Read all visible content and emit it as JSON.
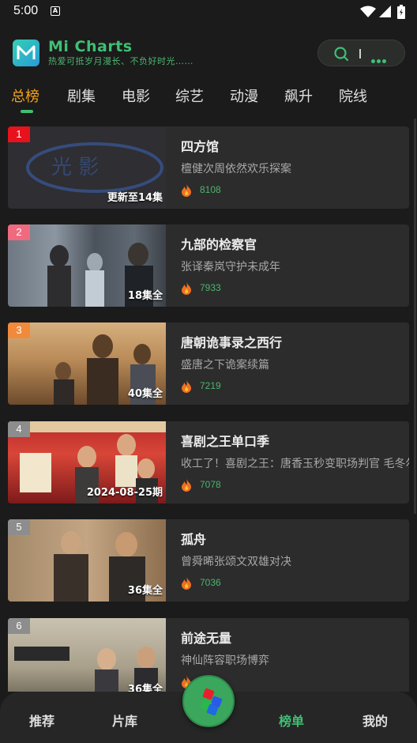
{
  "status_bar": {
    "time": "5:00",
    "notif_glyph": "A"
  },
  "header": {
    "app_title": "Mi Charts",
    "slogan": "热爱可抵岁月漫长、不负好时光……",
    "logo_letter": "M"
  },
  "tabs": [
    {
      "label": "总榜",
      "active": true
    },
    {
      "label": "剧集",
      "active": false
    },
    {
      "label": "电影",
      "active": false
    },
    {
      "label": "综艺",
      "active": false
    },
    {
      "label": "动漫",
      "active": false
    },
    {
      "label": "飙升",
      "active": false
    },
    {
      "label": "院线",
      "active": false
    }
  ],
  "items": [
    {
      "rank": "1",
      "rank_color": "#e8121c",
      "title": "四方馆",
      "desc": "檀健次周依然欢乐探案",
      "heat": "8108",
      "episode": "更新至14集",
      "thumb_text": "光 影"
    },
    {
      "rank": "2",
      "rank_color": "#ef6a7f",
      "title": "九部的检察官",
      "desc": "张译秦岚守护未成年",
      "heat": "7933",
      "episode": "18集全"
    },
    {
      "rank": "3",
      "rank_color": "#f28a3c",
      "title": "唐朝诡事录之西行",
      "desc": "盛唐之下诡案续篇",
      "heat": "7219",
      "episode": "40集全"
    },
    {
      "rank": "4",
      "rank_color": "#8d8d8d",
      "title": "喜剧之王单口季",
      "desc": "收工了！喜剧之王：唐香玉秒变职场判官 毛冬尔",
      "heat": "7078",
      "episode": "2024-08-25期"
    },
    {
      "rank": "5",
      "rank_color": "#8d8d8d",
      "title": "孤舟",
      "desc": "曾舜晞张颂文双雄对决",
      "heat": "7036",
      "episode": "36集全"
    },
    {
      "rank": "6",
      "rank_color": "#8d8d8d",
      "title": "前途无量",
      "desc": "神仙阵容职场博弈",
      "heat": "",
      "episode": "36集全"
    }
  ],
  "bottom_nav": [
    {
      "label": "推荐",
      "active": false
    },
    {
      "label": "片库",
      "active": false
    },
    {
      "label": "榜单",
      "active": true
    },
    {
      "label": "我的",
      "active": false
    }
  ],
  "colors": {
    "accent_green": "#3fbf73",
    "tab_active": "#f4a21c",
    "background": "#1b1b1b"
  }
}
